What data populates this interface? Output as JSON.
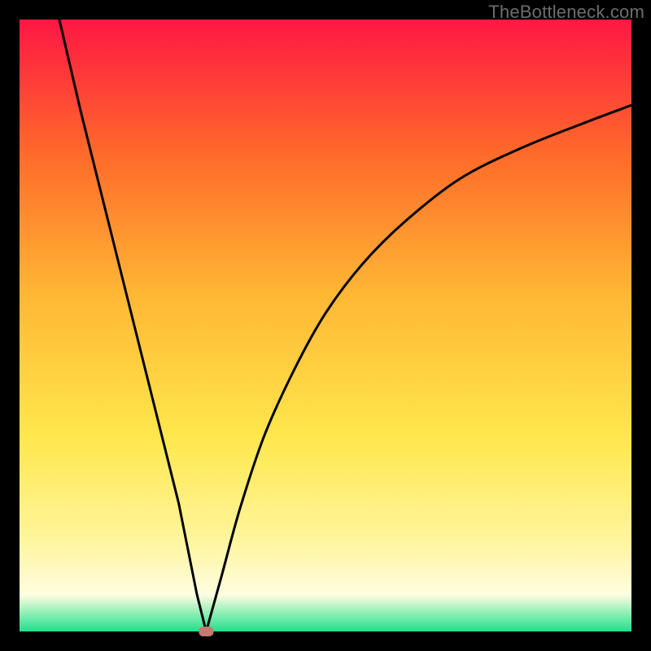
{
  "watermark": "TheBottleneck.com",
  "chart_data": {
    "type": "line",
    "title": "",
    "xlabel": "",
    "ylabel": "",
    "xlim": [
      0,
      100
    ],
    "ylim": [
      0,
      100
    ],
    "axes_visible": false,
    "gridlines": false,
    "background_gradient": {
      "top": "#ff1744",
      "mid1": "#ff6a2a",
      "mid2": "#ffb734",
      "mid3": "#ffe74c",
      "mid4": "#fff59d",
      "mid5": "#fffde0",
      "bottom": "#1fe08a"
    },
    "border": "#000000",
    "left_curve": {
      "start_x": 6.5,
      "start_y": 100,
      "end_x": 30.5,
      "end_y": 0,
      "note": "Near-linear descending left branch from top-left to the minimum"
    },
    "right_curve": {
      "start_x": 30.5,
      "start_y": 0,
      "end_x": 100,
      "end_y": 86,
      "note": "Curved ascending right branch with decreasing slope"
    },
    "minimum_marker": {
      "x": 30.5,
      "y": 0,
      "shape": "rounded-rect",
      "fill": "#c47a6f"
    },
    "series": [
      {
        "name": "curve",
        "x": [
          6.5,
          10,
          14,
          18,
          22,
          26,
          29,
          30.5,
          33,
          36,
          40,
          45,
          50,
          56,
          63,
          72,
          82,
          92,
          100
        ],
        "y": [
          100,
          85,
          69,
          53,
          37,
          21,
          6,
          0,
          9,
          20,
          32,
          43,
          52,
          60,
          67,
          74,
          79,
          83,
          86
        ]
      }
    ]
  }
}
